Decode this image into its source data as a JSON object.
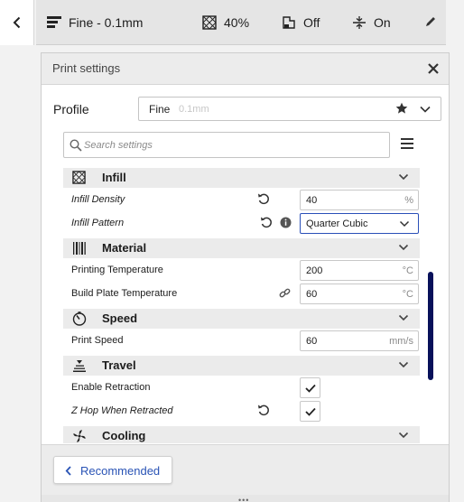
{
  "topbar": {
    "back_icon": "chevron-left-icon",
    "profile": "Fine - 0.1mm",
    "infill": "40%",
    "support": "Off",
    "adhesion": "On",
    "edit_icon": "pencil-icon"
  },
  "panel": {
    "title": "Print settings",
    "close_icon": "close-icon"
  },
  "profile": {
    "label": "Profile",
    "name": "Fine",
    "quality": "0.1mm",
    "favorite_icon": "star-icon",
    "dropdown_icon": "chevron-down-icon"
  },
  "search": {
    "placeholder": "Search settings",
    "menu_icon": "hamburger-icon"
  },
  "categories": {
    "infill": "Infill",
    "material": "Material",
    "speed": "Speed",
    "travel": "Travel",
    "cooling": "Cooling"
  },
  "settings": {
    "infill_density": {
      "label": "Infill Density",
      "value": "40",
      "unit": "%"
    },
    "infill_pattern": {
      "label": "Infill Pattern",
      "value": "Quarter Cubic"
    },
    "printing_temperature": {
      "label": "Printing Temperature",
      "value": "200",
      "unit": "°C"
    },
    "build_plate_temperature": {
      "label": "Build Plate Temperature",
      "value": "60",
      "unit": "°C"
    },
    "print_speed": {
      "label": "Print Speed",
      "value": "60",
      "unit": "mm/s"
    },
    "enable_retraction": {
      "label": "Enable Retraction",
      "checked": true
    },
    "z_hop_when_retracted": {
      "label": "Z Hop When Retracted",
      "checked": true
    }
  },
  "footer": {
    "recommended": "Recommended"
  },
  "colors": {
    "accent": "#2953b5",
    "scrollbar": "#08115a",
    "category_bg": "#ebebeb"
  }
}
